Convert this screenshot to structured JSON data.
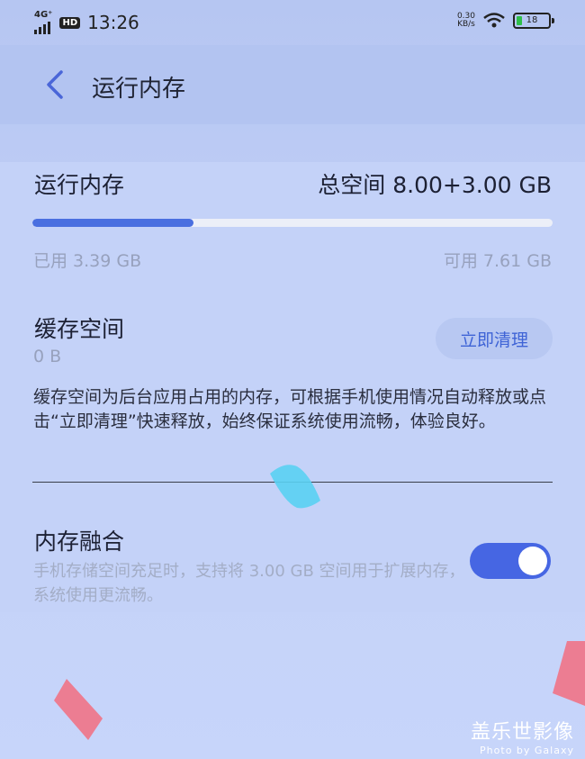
{
  "status_bar": {
    "network": "4G⁺",
    "hd": "HD",
    "time": "13:26",
    "speed_value": "0.30",
    "speed_unit": "KB/s",
    "battery": "18"
  },
  "header": {
    "title": "运行内存"
  },
  "memory": {
    "label": "运行内存",
    "total": "总空间 8.00+3.00 GB",
    "used": "已用 3.39 GB",
    "available": "可用 7.61 GB",
    "used_fraction": 0.31
  },
  "cache": {
    "label": "缓存空间",
    "size": "0 B",
    "clean_button": "立即清理",
    "description": "缓存空间为后台应用占用的内存，可根据手机使用情况自动释放或点击“立即清理”快速释放，始终保证系统使用流畅，体验良好。"
  },
  "fusion": {
    "label": "内存融合",
    "description": "手机存储空间充足时，支持将 3.00 GB 空间用于扩展内存，系统使用更流畅。",
    "enabled": true
  },
  "watermark": {
    "line1": "盖乐世影像",
    "line2": "Photo by Galaxy"
  },
  "colors": {
    "accent": "#4a6fe0",
    "toggle_on": "#4666e3",
    "secondary_text": "#97a1bd"
  }
}
